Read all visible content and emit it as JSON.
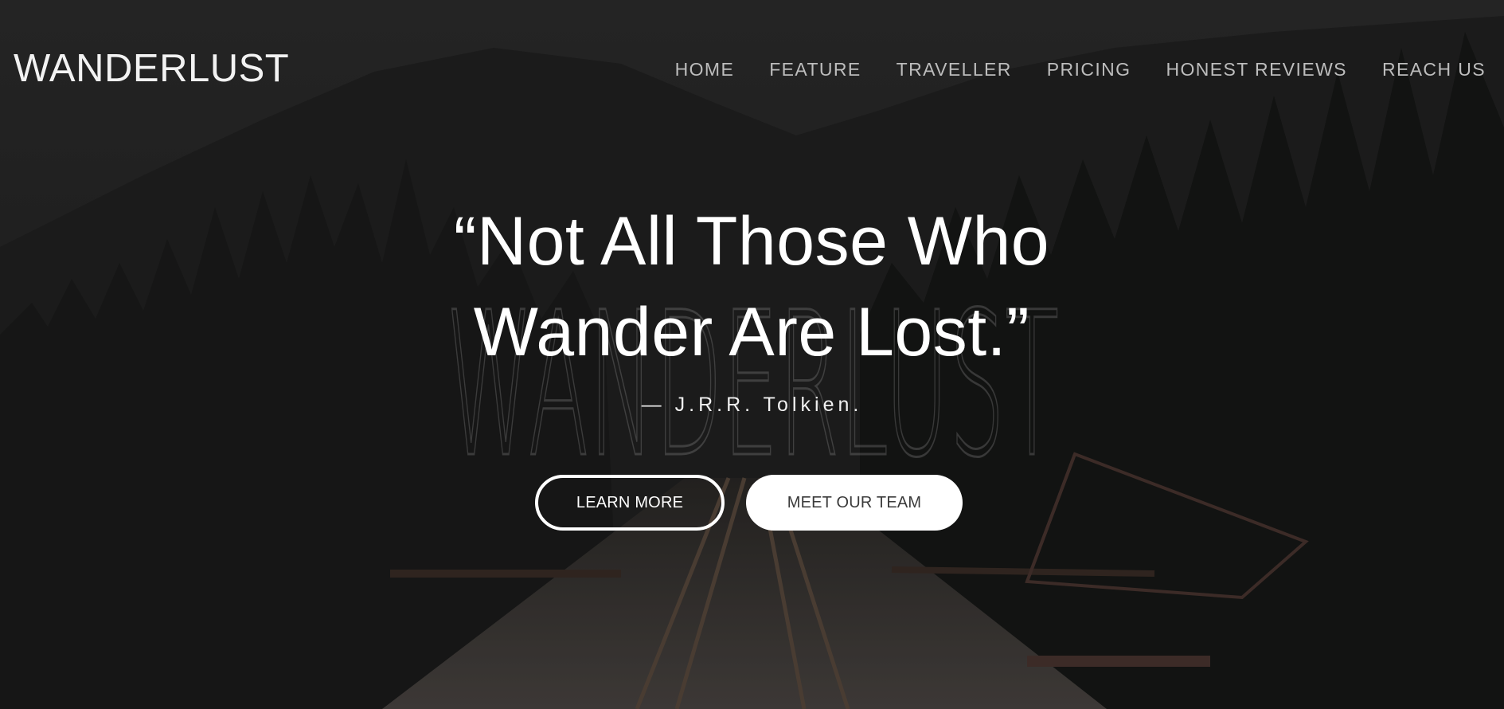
{
  "header": {
    "logo": "WANDERLUST",
    "nav": [
      {
        "label": "HOME"
      },
      {
        "label": "FEATURE"
      },
      {
        "label": "TRAVELLER"
      },
      {
        "label": "PRICING"
      },
      {
        "label": "HONEST REVIEWS"
      },
      {
        "label": "REACH US"
      }
    ]
  },
  "hero": {
    "quote_line1": "“Not All Those Who",
    "quote_line2": "Wander Are Lost.”",
    "author": "— J.R.R. Tolkien.",
    "watermark": "WANDERLUST",
    "buttons": {
      "learn_more": "LEARN MORE",
      "meet_team": "MEET OUR TEAM"
    }
  },
  "colors": {
    "background": "#1f1f1f",
    "text": "#ffffff",
    "nav_text": "#bdbdbd",
    "button_text_dark": "#3a3a3a"
  }
}
